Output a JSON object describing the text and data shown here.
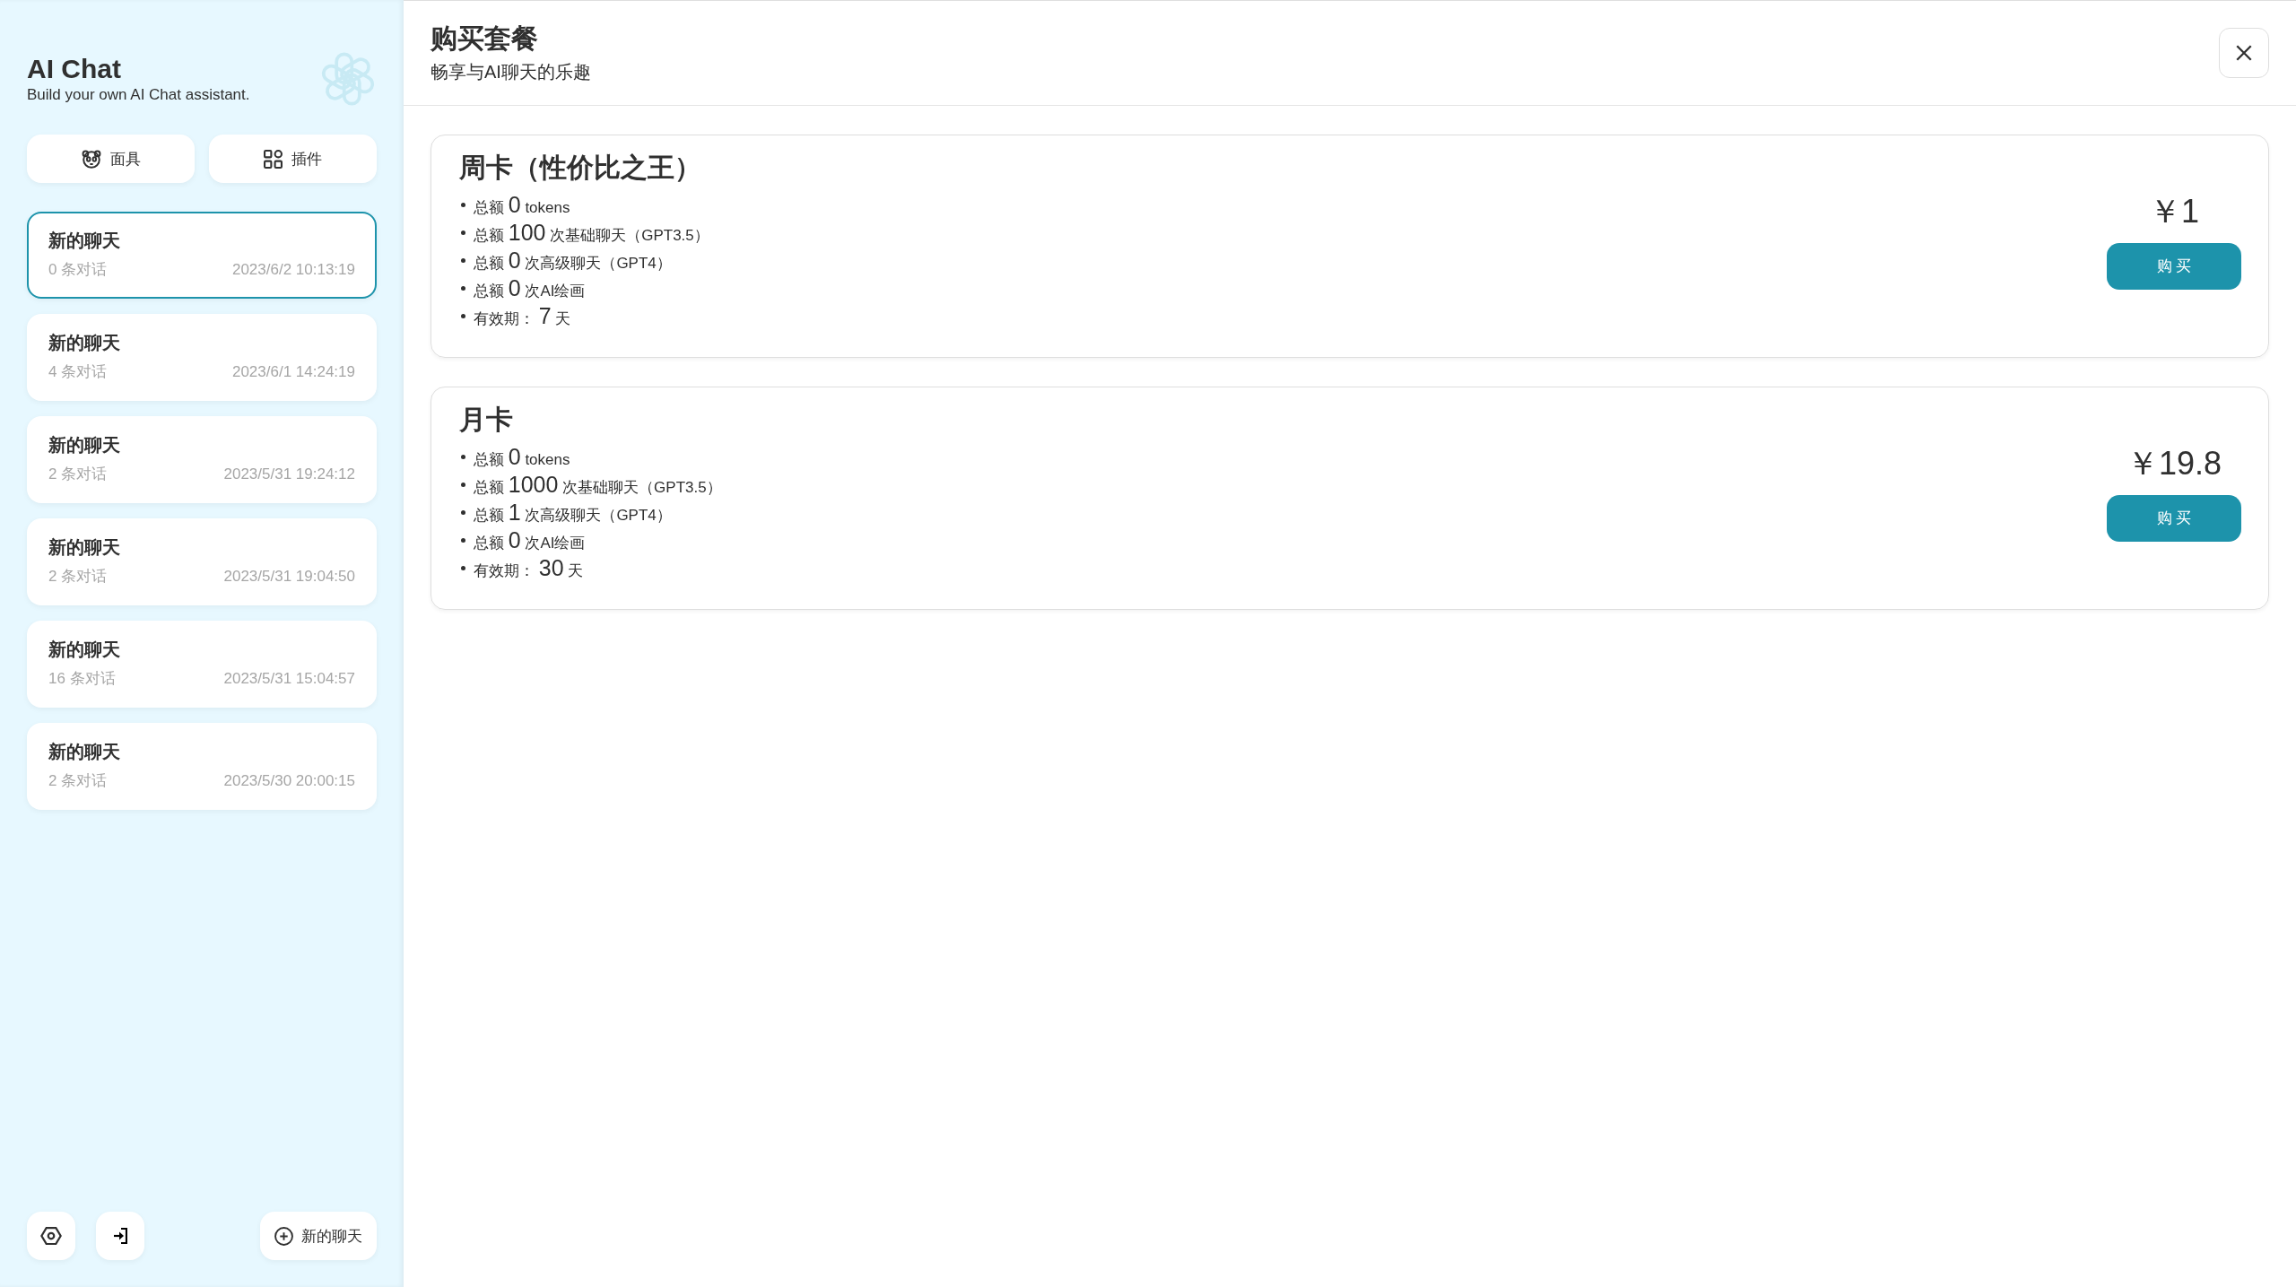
{
  "sidebar": {
    "title": "AI Chat",
    "subtitle": "Build your own AI Chat assistant.",
    "tools": [
      {
        "kind": "mask",
        "label": "面具"
      },
      {
        "kind": "plugin",
        "label": "插件"
      }
    ],
    "chats": [
      {
        "title": "新的聊天",
        "count": "0 条对话",
        "time": "2023/6/2 10:13:19",
        "selected": true
      },
      {
        "title": "新的聊天",
        "count": "4 条对话",
        "time": "2023/6/1 14:24:19",
        "selected": false
      },
      {
        "title": "新的聊天",
        "count": "2 条对话",
        "time": "2023/5/31 19:24:12",
        "selected": false
      },
      {
        "title": "新的聊天",
        "count": "2 条对话",
        "time": "2023/5/31 19:04:50",
        "selected": false
      },
      {
        "title": "新的聊天",
        "count": "16 条对话",
        "time": "2023/5/31 15:04:57",
        "selected": false
      },
      {
        "title": "新的聊天",
        "count": "2 条对话",
        "time": "2023/5/30 20:00:15",
        "selected": false
      }
    ],
    "new_chat": "新的聊天"
  },
  "dialog": {
    "title": "购买套餐",
    "subtitle": "畅享与AI聊天的乐趣",
    "plans": [
      {
        "name": "周卡（性价比之王）",
        "features": [
          {
            "label": "总额",
            "amount": "0",
            "unit": "tokens"
          },
          {
            "label": "总额",
            "amount": "100",
            "unit": "次基础聊天（GPT3.5）"
          },
          {
            "label": "总额",
            "amount": "0",
            "unit": "次高级聊天（GPT4）"
          },
          {
            "label": "总额",
            "amount": "0",
            "unit": "次AI绘画"
          },
          {
            "label": "有效期：",
            "amount": "7",
            "unit": "天"
          }
        ],
        "price": "￥1",
        "button": "购 买"
      },
      {
        "name": "月卡",
        "features": [
          {
            "label": "总额",
            "amount": "0",
            "unit": "tokens"
          },
          {
            "label": "总额",
            "amount": "1000",
            "unit": "次基础聊天（GPT3.5）"
          },
          {
            "label": "总额",
            "amount": "1",
            "unit": "次高级聊天（GPT4）"
          },
          {
            "label": "总额",
            "amount": "0",
            "unit": "次AI绘画"
          },
          {
            "label": "有效期：",
            "amount": "30",
            "unit": "天"
          }
        ],
        "price": "￥19.8",
        "button": "购 买"
      }
    ]
  }
}
